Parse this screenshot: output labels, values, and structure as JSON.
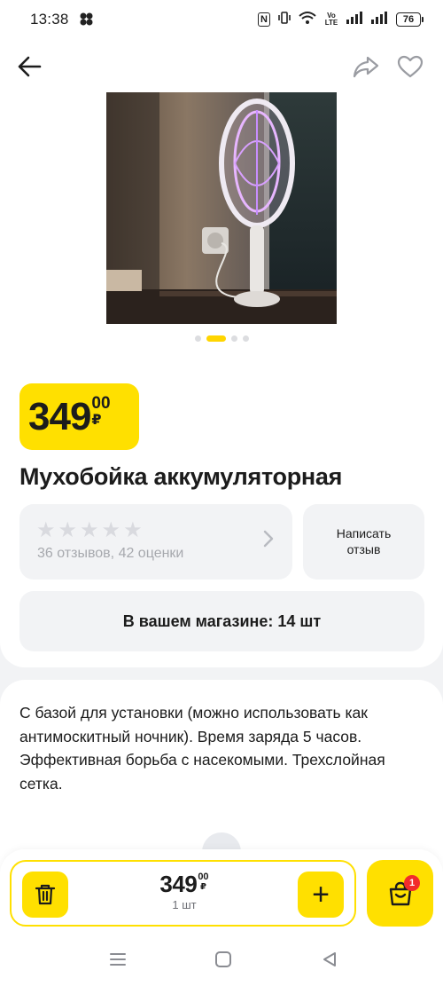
{
  "status_bar": {
    "time": "13:38",
    "nfc": "N",
    "volte": "Vo LTE",
    "battery": "76"
  },
  "product": {
    "title": "Мухобойка аккумуляторная",
    "price_int": "349",
    "price_cents": "00",
    "currency": "₽",
    "image_slides": 4,
    "active_slide": 1
  },
  "rating": {
    "stars_filled": 0,
    "stars_total": 5,
    "summary": "36 отзывов, 42 оценки"
  },
  "review_button": {
    "label_line1": "Написать",
    "label_line2": "отзыв"
  },
  "stock": {
    "text": "В вашем магазине: 14 шт"
  },
  "description": {
    "text": "С базой для установки (можно использовать как антимоскитный ночник). Время заряда 5 часов. Эффективная борьба с насекомыми. Трехслойная сетка."
  },
  "cart_control": {
    "price_int": "349",
    "price_cents": "00",
    "currency": "₽",
    "quantity": "1 шт",
    "plus": "+"
  },
  "cart": {
    "badge": "1"
  },
  "icons": {
    "back": "arrow-left-icon",
    "share": "share-icon",
    "favorite": "heart-icon",
    "delete": "trash-icon",
    "cart": "shopping-bag-icon"
  },
  "colors": {
    "accent": "#ffe000",
    "badge": "#f22b2b",
    "background": "#f2f3f5"
  }
}
